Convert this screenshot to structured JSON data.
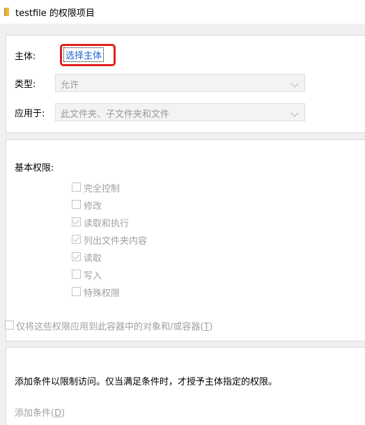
{
  "window": {
    "title": "testfile 的权限项目"
  },
  "principal": {
    "label": "主体:",
    "link": "选择主体"
  },
  "type": {
    "label": "类型:",
    "value": "允许"
  },
  "applies_to": {
    "label": "应用于:",
    "value": "此文件夹、子文件夹和文件"
  },
  "basic_permissions": {
    "label": "基本权限:",
    "items": [
      {
        "label": "完全控制",
        "checked": false
      },
      {
        "label": "修改",
        "checked": false
      },
      {
        "label": "读取和执行",
        "checked": true
      },
      {
        "label": "列出文件夹内容",
        "checked": true
      },
      {
        "label": "读取",
        "checked": true
      },
      {
        "label": "写入",
        "checked": false
      },
      {
        "label": "特殊权限",
        "checked": false
      }
    ],
    "apply_only_text": "仅将这些权限应用到此容器中的对象和/或容器",
    "apply_only_key": "T"
  },
  "conditions": {
    "description": "添加条件以限制访问。仅当满足条件时，才授予主体指定的权限。",
    "add_label": "添加条件",
    "add_key": "D"
  },
  "colors": {
    "highlight": "#e0201b",
    "link": "#1e62d0"
  }
}
